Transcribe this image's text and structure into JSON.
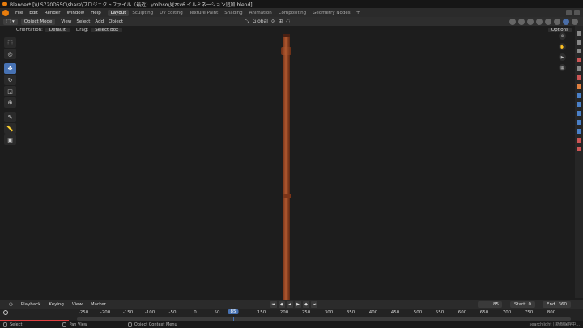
{
  "window": {
    "title": "Blender* [\\\\LS720D55C\\share\\プロジェクトファイル（最近）\\coloso\\見本v6 イルミネーション追加.blend]"
  },
  "topbar": {
    "menu": [
      "File",
      "Edit",
      "Render",
      "Window",
      "Help"
    ],
    "workspaces": [
      "Layout",
      "Sculpting",
      "UV Editing",
      "Texture Paint",
      "Shading",
      "Animation",
      "Compositing",
      "Geometry Nodes"
    ],
    "active_workspace": "Layout",
    "add_tab": "+"
  },
  "viewport_header": {
    "mode": "Object Mode",
    "menu": [
      "View",
      "Select",
      "Add",
      "Object"
    ],
    "transform_orientation": "Global"
  },
  "tool_settings": {
    "orientation_label": "Orientation:",
    "orientation_value": "Default",
    "drag_label": "Drag:",
    "drag_value": "Select Box",
    "options": "Options"
  },
  "toolbar": {
    "tools": [
      "select-box",
      "cursor",
      "move",
      "rotate",
      "scale",
      "transform",
      "annotate",
      "measure",
      "add-cube"
    ],
    "active": "move"
  },
  "timeline": {
    "menu": [
      "Playback",
      "Keying",
      "View",
      "Marker"
    ],
    "current_frame": "85",
    "start_label": "Start",
    "start_value": "0",
    "end_label": "End",
    "end_value": "360",
    "ruler": [
      "-250",
      "-200",
      "-150",
      "-100",
      "-50",
      "0",
      "50",
      "85",
      "150",
      "200",
      "250",
      "300",
      "350",
      "400",
      "450",
      "500",
      "550",
      "600",
      "650",
      "700",
      "750",
      "800"
    ]
  },
  "statusbar": {
    "select": "Select",
    "pan": "Pan View",
    "context": "Object Context Menu",
    "info": "searchlight | 新規保存中..."
  },
  "colors": {
    "accent": "#4772b3",
    "pole": "#9c4a28",
    "viewport_bg": "#3a3a3a"
  }
}
